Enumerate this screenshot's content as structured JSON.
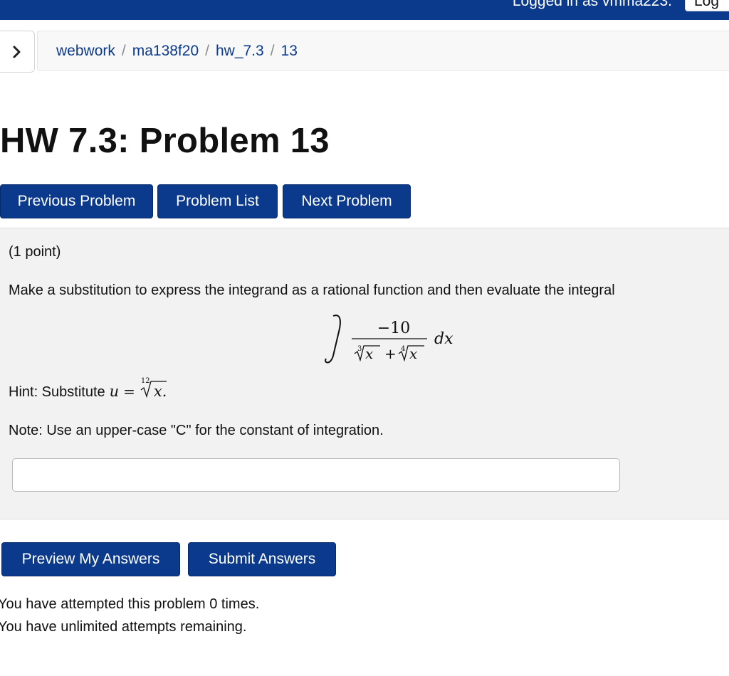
{
  "header": {
    "login_text": "Logged in as vmma223.",
    "logout_label": "Log out"
  },
  "breadcrumb": {
    "items": [
      "webwork",
      "ma138f20",
      "hw_7.3",
      "13"
    ],
    "separator": "/"
  },
  "page_title": "HW 7.3: Problem 13",
  "nav": {
    "previous": "Previous Problem",
    "list": "Problem List",
    "next": "Next Problem"
  },
  "problem": {
    "points": "(1 point)",
    "statement": "Make a substitution to express the integrand as a rational function and then evaluate the integral",
    "integral": {
      "numerator": "−10",
      "denominator_first_index": "3",
      "denominator_second_index": "4",
      "radicand": "x",
      "plus": "+",
      "differential": "dx"
    },
    "hint_prefix": "Hint: Substitute",
    "hint_variable": "u",
    "hint_equals": "=",
    "hint_root_index": "12",
    "hint_radicand": "x.",
    "note": "Note: Use an upper-case \"C\" for the constant of integration.",
    "answer_value": ""
  },
  "actions": {
    "preview": "Preview My Answers",
    "submit": "Submit Answers"
  },
  "status": {
    "attempted": "You have attempted this problem 0 times.",
    "remaining": "You have unlimited attempts remaining."
  },
  "colors": {
    "brand_blue": "#0b3a8c",
    "problem_background": "#f2f2f2"
  }
}
